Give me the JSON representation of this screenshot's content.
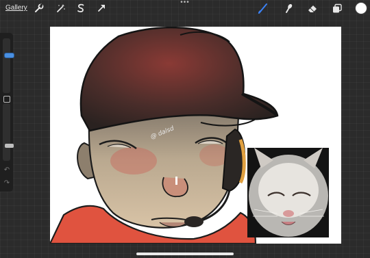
{
  "toolbar": {
    "gallery_label": "Gallery",
    "left_tools": [
      "wrench-icon",
      "magic-wand-icon",
      "selection-s-icon",
      "transform-arrow-icon"
    ],
    "right_tools": [
      "brush-icon",
      "smudge-icon",
      "eraser-icon",
      "layers-icon"
    ],
    "active_tool_color": "#3b82f6",
    "current_color": "#ffffff"
  },
  "sidebar": {
    "brush_size_fraction": 0.7,
    "opacity_fraction": 0.2
  },
  "canvas": {
    "signature": "@ dalsd"
  }
}
